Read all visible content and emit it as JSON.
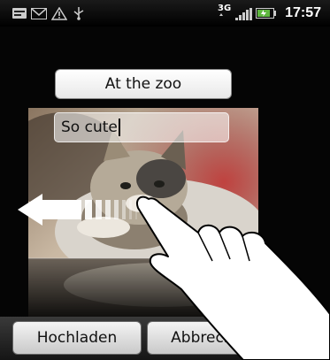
{
  "status_bar": {
    "time": "17:57",
    "network_label": "3G",
    "icons": [
      "message-icon",
      "gmail-icon",
      "warning-icon",
      "usb-icon",
      "3g-data-icon",
      "signal-icon",
      "battery-icon"
    ]
  },
  "upload_form": {
    "title_value": "At the zoo",
    "description_value": "So cute"
  },
  "buttons": {
    "upload_label": "Hochladen",
    "cancel_label": "Abbrechen"
  },
  "overlays": {
    "gesture": "swipe-left",
    "hand_icon": "pointing-hand-icon",
    "arrow_icon": "swipe-left-arrow-icon"
  }
}
